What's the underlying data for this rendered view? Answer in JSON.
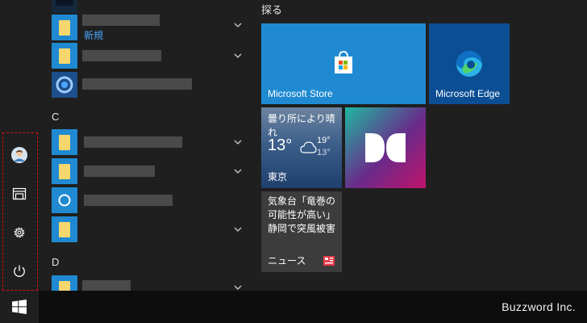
{
  "app_list": {
    "new_badge": "新規",
    "section_c": "C",
    "section_d": "D"
  },
  "tiles": {
    "group_title": "探る",
    "store": {
      "label": "Microsoft Store",
      "color": "#1f8ad2"
    },
    "edge": {
      "label": "Microsoft Edge",
      "color": "#0b4e94"
    },
    "weather": {
      "condition": "曇り所により晴れ",
      "temp": "13°",
      "high": "19°",
      "low": "13°",
      "city": "東京"
    },
    "dolby": {
      "icon": "dolby-icon"
    },
    "news": {
      "headline": "気象台「竜巻の可能性が高い」静岡で突風被害",
      "label": "ニュース"
    }
  },
  "rail": {
    "highlight_color": "#e01010",
    "items": [
      {
        "icon": "user-avatar-icon"
      },
      {
        "icon": "documents-icon"
      },
      {
        "icon": "gear-icon"
      },
      {
        "icon": "power-icon"
      }
    ]
  },
  "taskbar": {
    "start_icon": "windows-logo-icon",
    "watermark": "Buzzword Inc."
  }
}
